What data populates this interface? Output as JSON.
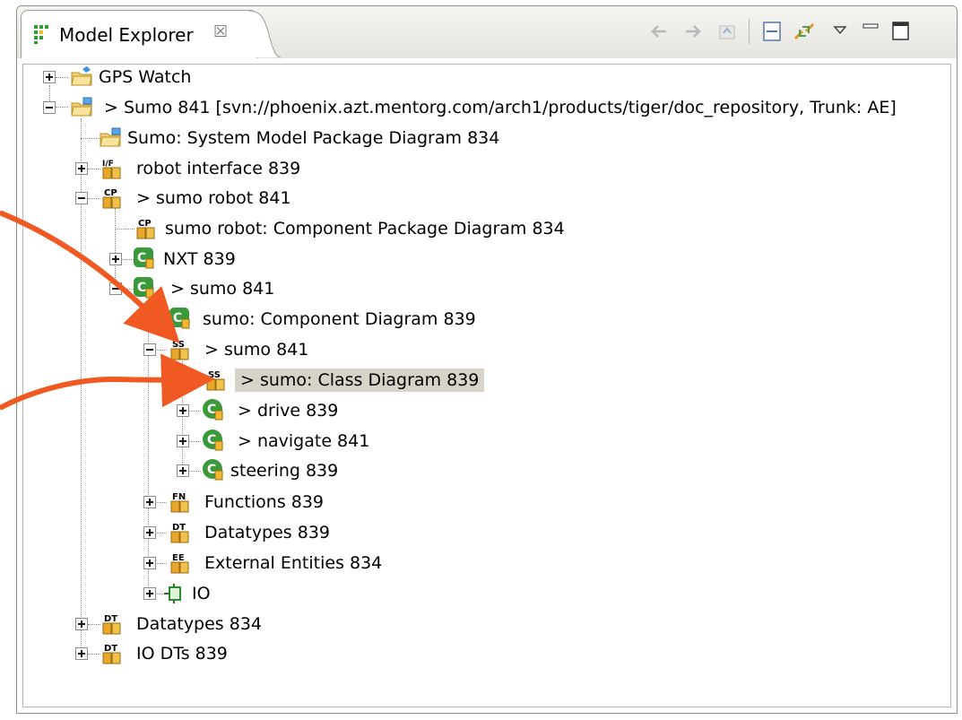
{
  "view": {
    "title": "Model Explorer",
    "close_glyph": "☒"
  },
  "toolbar": {
    "buttons": [
      "back-icon",
      "forward-icon",
      "home-icon",
      "collapse-all-icon",
      "link-with-editor-icon",
      "view-menu-icon",
      "minimize-icon",
      "maximize-icon"
    ]
  },
  "colors": {
    "selection": "#d8d3c9",
    "annotation_arrow": "#f05a22",
    "class_icon_green": "#3a9a3a"
  },
  "tree": {
    "rows": [
      {
        "label": "GPS Watch"
      },
      {
        "label": "> Sumo 841 [svn://phoenix.azt.mentorg.com/arch1/products/tiger/doc_repository, Trunk: AE]"
      },
      {
        "label": "Sumo: System Model Package Diagram 834"
      },
      {
        "label": "robot interface 839"
      },
      {
        "label": "> sumo robot 841"
      },
      {
        "label": "sumo robot: Component Package Diagram 834"
      },
      {
        "label": "NXT 839"
      },
      {
        "label": "> sumo 841"
      },
      {
        "label": "sumo: Component Diagram 839"
      },
      {
        "label": "> sumo 841"
      },
      {
        "label": "> sumo: Class Diagram 839"
      },
      {
        "label": "> drive 839"
      },
      {
        "label": "> navigate 841"
      },
      {
        "label": "steering 839"
      },
      {
        "label": "Functions 839"
      },
      {
        "label": "Datatypes 839"
      },
      {
        "label": "External Entities 834"
      },
      {
        "label": "IO"
      },
      {
        "label": "Datatypes 834"
      },
      {
        "label": "IO DTs 839"
      }
    ]
  },
  "icons": {
    "if_tag": "I/F",
    "cp_tag": "CP",
    "ss_tag": "SS",
    "fn_tag": "FN",
    "dt_tag": "DT",
    "ee_tag": "EE",
    "c_tag": "C"
  }
}
